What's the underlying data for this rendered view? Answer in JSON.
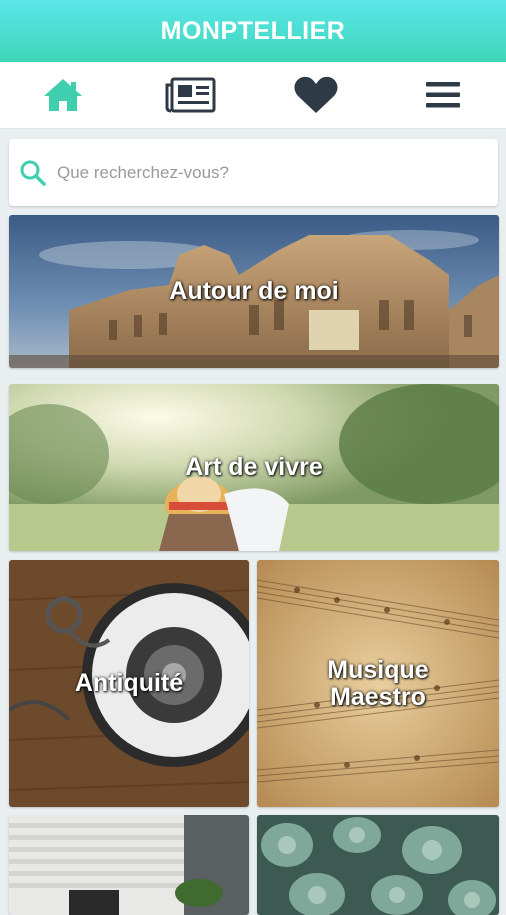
{
  "header": {
    "title": "MONPTELLIER"
  },
  "nav": {
    "items": [
      {
        "icon": "home-icon",
        "color": "#3fcfae"
      },
      {
        "icon": "newspaper-icon",
        "color": "#2f3a47"
      },
      {
        "icon": "heart-icon",
        "color": "#2f3a47"
      },
      {
        "icon": "menu-icon",
        "color": "#2f3a47"
      }
    ]
  },
  "search": {
    "placeholder": "Que recherchez-vous?",
    "icon": "search-icon",
    "icon_color": "#3fcfae"
  },
  "tiles": [
    {
      "label": "Autour de moi"
    },
    {
      "label": "Art de vivre"
    },
    {
      "label": "Antiquité"
    },
    {
      "label": "Musique\nMaestro"
    },
    {
      "label": ""
    },
    {
      "label": ""
    }
  ]
}
